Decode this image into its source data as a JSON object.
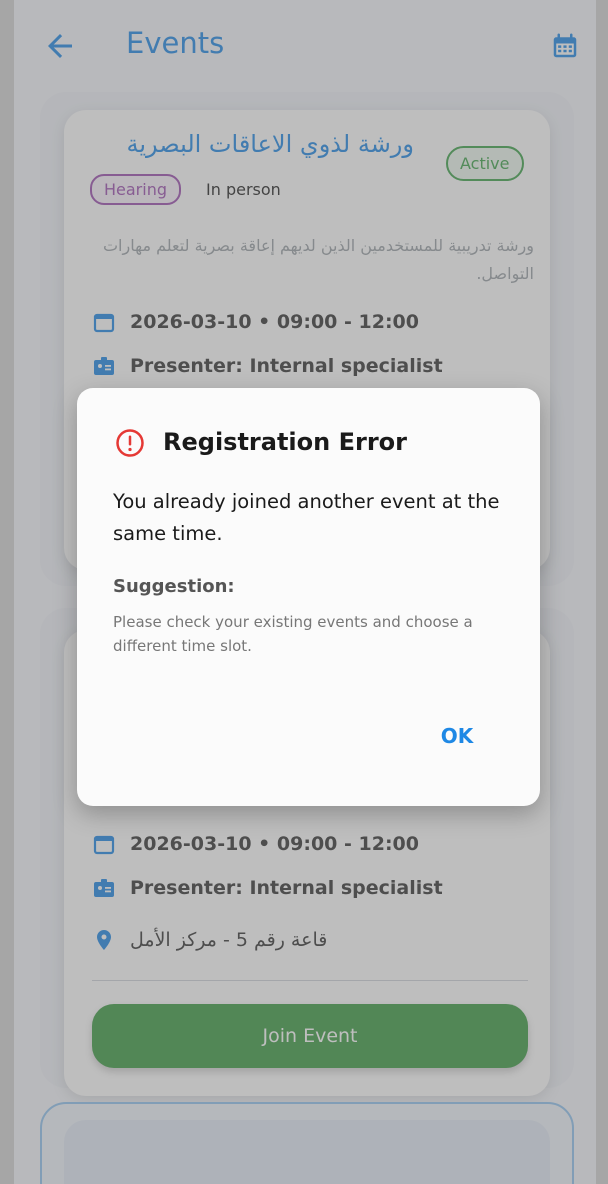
{
  "appbar": {
    "title": "Events"
  },
  "event1": {
    "title": "ورشة لذوي الاعاقات البصرية",
    "category": "Hearing",
    "mode": "In person",
    "status": "Active",
    "description": "ورشة تدريبية للمستخدمين الذين لديهم إعاقة بصرية لتعلم مهارات التواصل.",
    "datetime": "2026-03-10 • 09:00 - 12:00",
    "presenter": "Presenter: Internal specialist"
  },
  "event2": {
    "datetime": "2026-03-10 • 09:00 - 12:00",
    "presenter": "Presenter: Internal specialist",
    "location": "قاعة رقم 5 - مركز الأمل",
    "join_label": "Join Event"
  },
  "dialog": {
    "title": "Registration Error",
    "message": "You already joined another event at the same time.",
    "suggestion_label": "Suggestion:",
    "suggestion_text": "Please check your existing events and choose a different time slot.",
    "ok_label": "OK"
  },
  "colors": {
    "primary": "#1e88e5",
    "success": "#3b9b43",
    "hearing": "#9c4db0",
    "error": "#e53935"
  }
}
